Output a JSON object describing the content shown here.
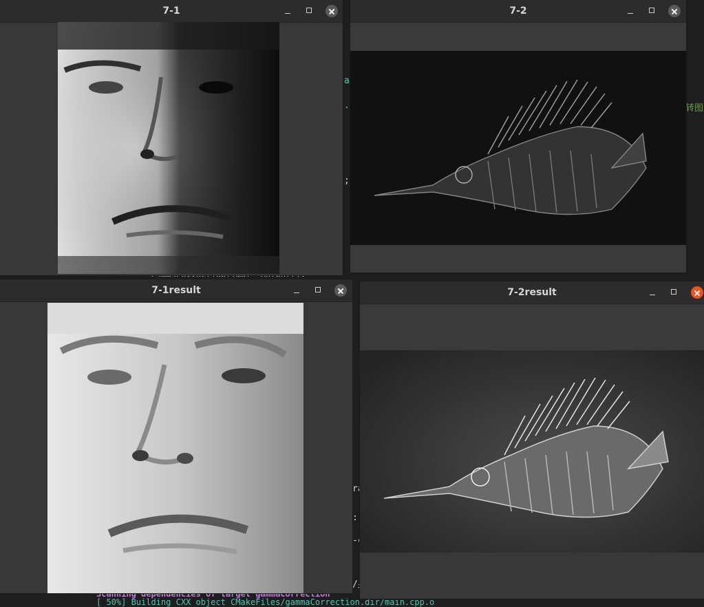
{
  "windows": [
    {
      "title": "7-1",
      "id": "w71"
    },
    {
      "title": "7-2",
      "id": "w72"
    },
    {
      "title": "7-1result",
      "id": "w71r"
    },
    {
      "title": "7-2result",
      "id": "w72r"
    }
  ],
  "background_editor": {
    "fragments": [
      "a",
      ".(",
      ";",
      "ra",
      ":]",
      "-c",
      "/身",
      "转图"
    ],
    "code_line": "GammaCorrection(imgl, Outputl);",
    "status_line": "Scanning dependencies of target gammaCorrection",
    "build_line": "[ 50%] Building CXX object CMakeFiles/gammaCorrection.dir/main.cpp.o"
  },
  "colors": {
    "titlebar": "#2c2c2c",
    "window_bg": "#383838",
    "close_active": "#e95420",
    "close_inactive": "#5a5a5a",
    "terminal_magenta": "#c678dd",
    "terminal_green": "#4ec9b0"
  }
}
